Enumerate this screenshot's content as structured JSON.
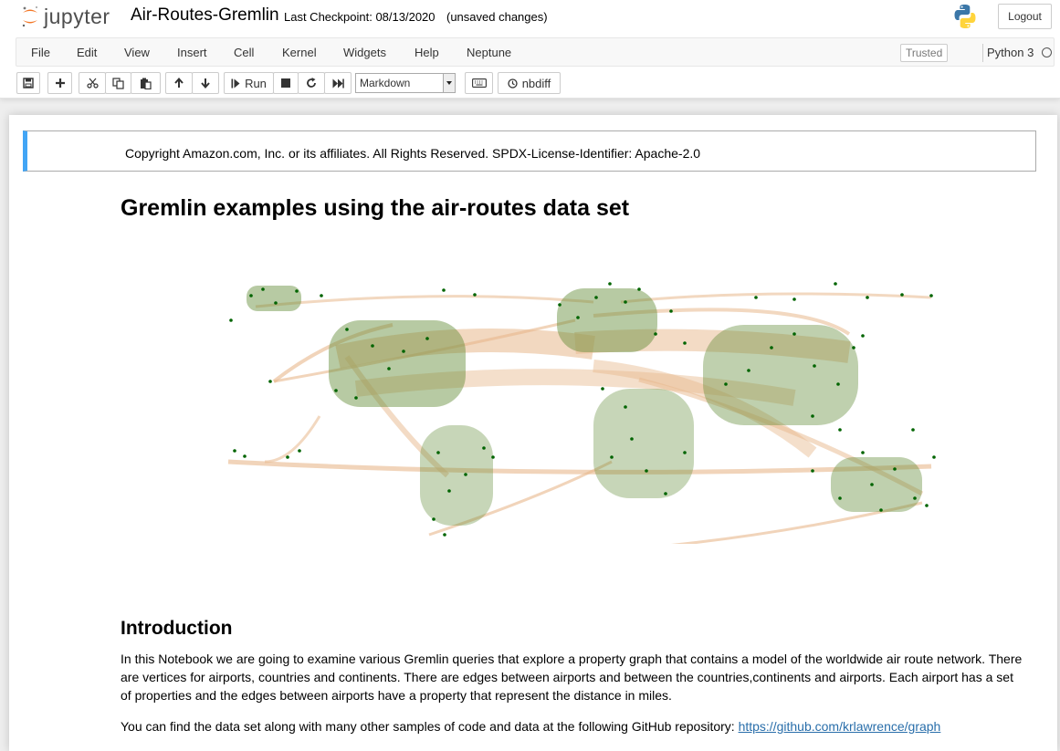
{
  "header": {
    "logo_text": "jupyter",
    "notebook_name": "Air-Routes-Gremlin",
    "checkpoint": "Last Checkpoint: 08/13/2020",
    "autosave_status": "(unsaved changes)",
    "logout_label": "Logout"
  },
  "menubar": {
    "items": [
      "File",
      "Edit",
      "View",
      "Insert",
      "Cell",
      "Kernel",
      "Widgets",
      "Help",
      "Neptune"
    ],
    "trusted_label": "Trusted",
    "kernel_name": "Python 3"
  },
  "toolbar": {
    "run_label": "Run",
    "cell_type": "Markdown",
    "nbdiff_label": "nbdiff",
    "icons": [
      "save-icon",
      "plus-icon",
      "cut-icon",
      "copy-icon",
      "paste-icon",
      "arrow-up-icon",
      "arrow-down-icon",
      "step-forward-icon",
      "stop-icon",
      "restart-icon",
      "fast-forward-icon",
      "keyboard-icon",
      "history-icon"
    ]
  },
  "notebook": {
    "copyright": "Copyright Amazon.com, Inc. or its affiliates. All Rights Reserved. SPDX-License-Identifier: Apache-2.0",
    "title": "Gremlin examples using the air-routes data set",
    "intro_heading": "Introduction",
    "intro_paragraph": "In this Notebook we are going to examine various Gremlin queries that explore a property graph that contains a model of the worldwide air route network. There are vertices for airports, countries and continents. There are edges between airports and between the countries,continents and airports. Each airport has a set of properties and the edges between airports have a property that represent the distance in miles.",
    "repo_text": "You can find the data set along with many other samples of code and data at the following GitHub repository: ",
    "repo_link": "https://github.com/krlawrence/graph"
  },
  "colors": {
    "route_edge": "#d9904a",
    "airport_node": "#006400",
    "markdown_indicator": "#42a5f5",
    "link": "#296eaa"
  }
}
